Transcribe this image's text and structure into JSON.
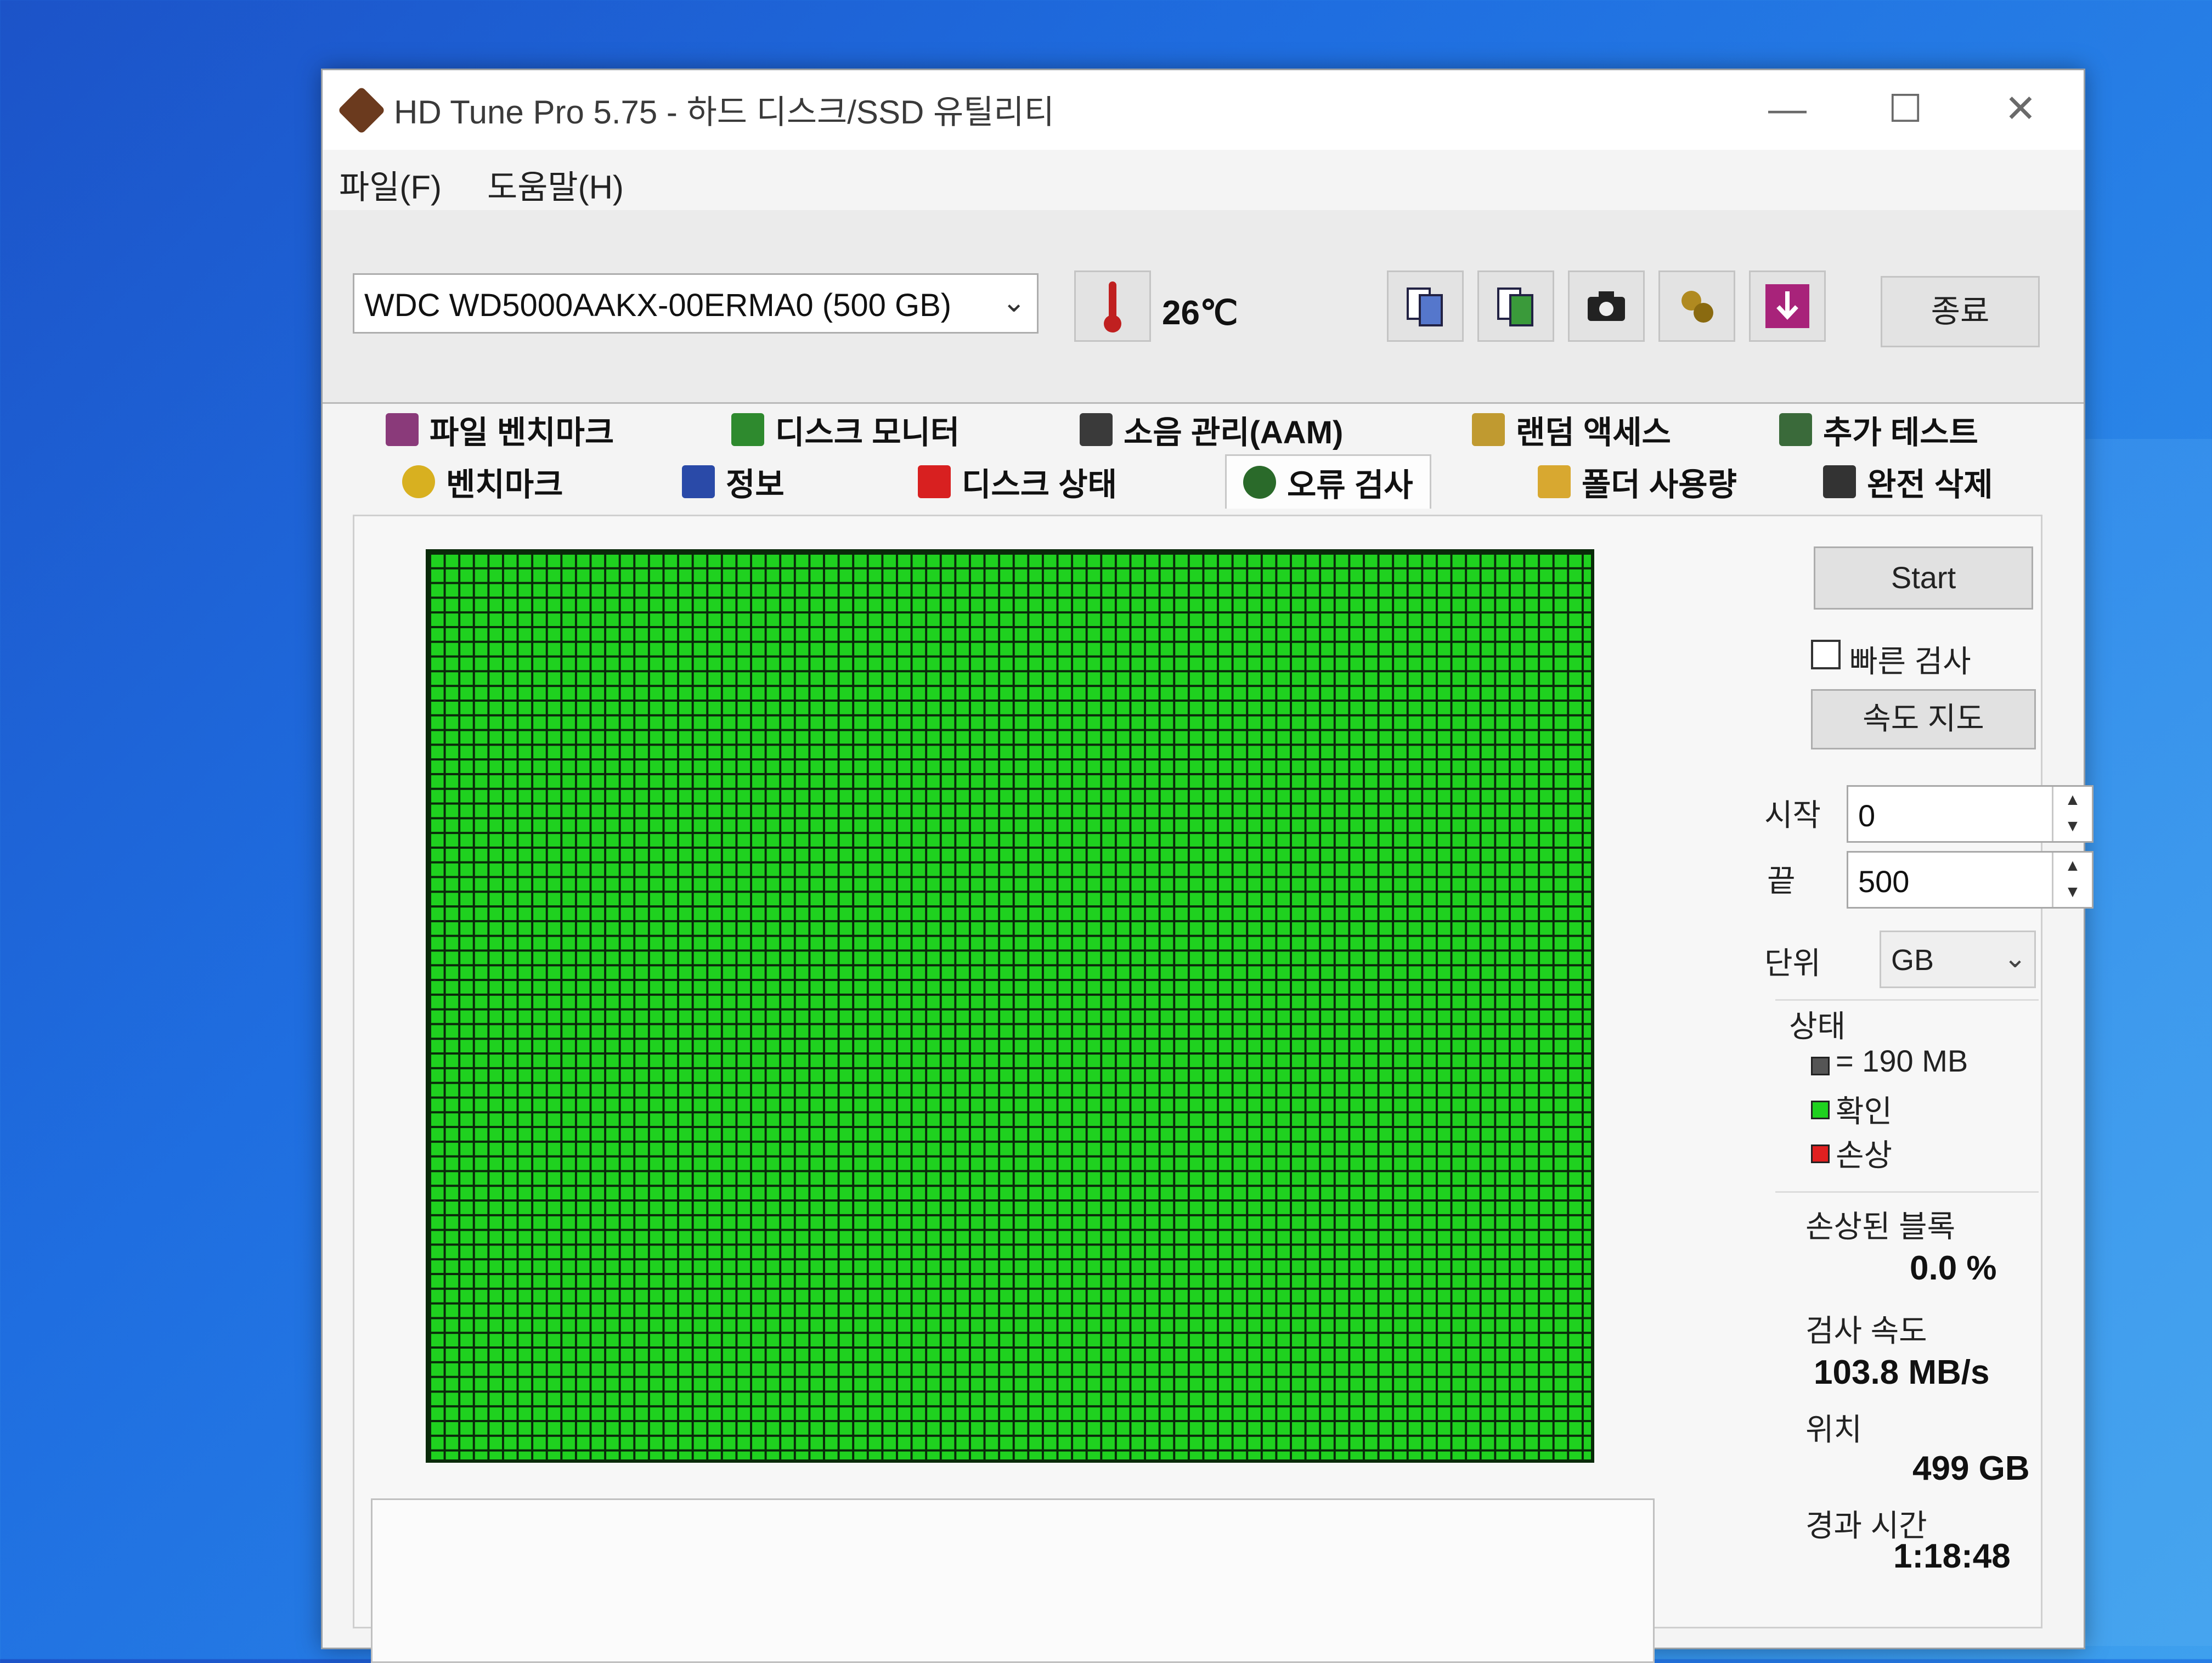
{
  "window": {
    "title": "HD Tune Pro 5.75 - 하드 디스크/SSD 유틸리티",
    "minimize": "—",
    "maximize": "☐",
    "close": "✕"
  },
  "menu": {
    "file": "파일(F)",
    "help": "도움말(H)"
  },
  "toolbar": {
    "drive": "WDC WD5000AAKX-00ERMA0 (500 GB)",
    "temperature": "26℃",
    "exit_label": "종료"
  },
  "tabs_row1": [
    {
      "label": "파일 벤치마크",
      "icon": "file-benchmark-icon"
    },
    {
      "label": "디스크 모니터",
      "icon": "disk-monitor-icon"
    },
    {
      "label": "소음 관리(AAM)",
      "icon": "speaker-icon"
    },
    {
      "label": "랜덤 액세스",
      "icon": "random-access-icon"
    },
    {
      "label": "추가 테스트",
      "icon": "extra-tests-icon"
    }
  ],
  "tabs_row2": [
    {
      "label": "벤치마크",
      "icon": "benchmark-icon"
    },
    {
      "label": "정보",
      "icon": "info-icon"
    },
    {
      "label": "디스크 상태",
      "icon": "health-cross-icon"
    },
    {
      "label": "오류 검사",
      "icon": "magnifier-icon",
      "active": true
    },
    {
      "label": "폴더 사용량",
      "icon": "folder-icon"
    },
    {
      "label": "완전 삭제",
      "icon": "trash-icon"
    }
  ],
  "panel": {
    "start_label": "Start",
    "quick_scan_label": "빠른 검사",
    "speed_map_label": "속도 지도",
    "start_field_label": "시작",
    "start_value": "0",
    "end_field_label": "끝",
    "end_value": "500",
    "unit_label": "단위",
    "unit_value": "GB",
    "status_label": "상태",
    "legend_block": "= 190 MB",
    "legend_ok": "확인",
    "legend_damaged": "손상",
    "damaged_blocks_label": "손상된 블록",
    "damaged_blocks_value": "0.0 %",
    "scan_speed_label": "검사 속도",
    "scan_speed_value": "103.8 MB/s",
    "position_label": "위치",
    "position_value": "499 GB",
    "elapsed_label": "경과 시간",
    "elapsed_value": "1:18:48"
  },
  "colors": {
    "ok": "#1fd11f",
    "damaged": "#e02020",
    "block": "#555555"
  },
  "scan": {
    "completed_fraction": 1.0
  }
}
